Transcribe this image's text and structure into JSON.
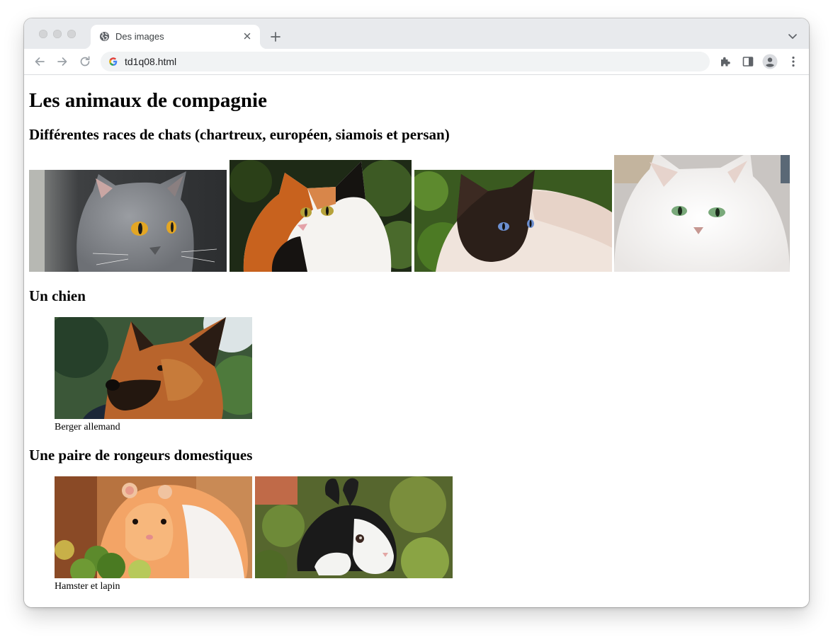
{
  "browser": {
    "tab_title": "Des images",
    "address": "td1q08.html",
    "icons": [
      "globe-icon",
      "close-icon",
      "plus-icon",
      "chevron-down-icon",
      "back-icon",
      "forward-icon",
      "reload-icon",
      "google-icon",
      "extensions-icon",
      "side-panel-icon",
      "profile-icon",
      "more-vert-icon"
    ]
  },
  "page": {
    "title": "Les animaux de compagnie",
    "cats_heading": "Différentes races de chats (chartreux, européen, siamois et persan)",
    "dog_heading": "Un chien",
    "dog_caption": "Berger allemand",
    "rodents_heading": "Une paire de rongeurs domestiques",
    "rodents_caption": "Hamster et lapin"
  }
}
